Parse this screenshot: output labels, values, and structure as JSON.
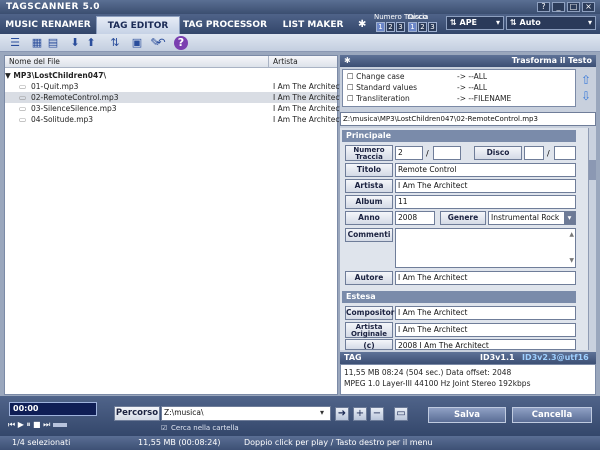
{
  "app": {
    "title": "TAGSCANNER 5.0",
    "window_buttons": [
      "?",
      "_",
      "□",
      "×"
    ]
  },
  "tabs": [
    {
      "label": "MUSIC RENAMER",
      "active": false
    },
    {
      "label": "TAG EDITOR",
      "active": true
    },
    {
      "label": "TAG PROCESSOR",
      "active": false
    },
    {
      "label": "LIST MAKER",
      "active": false
    }
  ],
  "topright": {
    "track_number_label": "Numero Traccia",
    "disc_label": "Disco",
    "track_digits": [
      "1",
      "2",
      "3"
    ],
    "disc_digits": [
      "1",
      "2",
      "3"
    ],
    "tag_format": "APE",
    "mode": "Auto"
  },
  "file_list": {
    "col_name": "Nome del File",
    "col_artist": "Artista",
    "folder": "MP3\\LostChildren047\\",
    "files": [
      {
        "name": "01-Quit.mp3",
        "artist": "I Am The Architect",
        "selected": false
      },
      {
        "name": "02-RemoteControl.mp3",
        "artist": "I Am The Architect",
        "selected": true
      },
      {
        "name": "03-SilenceSilence.mp3",
        "artist": "I Am The Architect",
        "selected": false
      },
      {
        "name": "04-Solitude.mp3",
        "artist": "I Am The Architect",
        "selected": false
      }
    ]
  },
  "transform": {
    "title": "Trasforma il Testo",
    "items": [
      {
        "label": "Change case",
        "target": "-> --ALL"
      },
      {
        "label": "Standard values",
        "target": "-> --ALL"
      },
      {
        "label": "Transliteration",
        "target": "-> --FILENAME"
      }
    ]
  },
  "path": "Z:\\musica\\MP3\\LostChildren047\\02-RemoteControl.mp3",
  "principale": {
    "section": "Principale",
    "track_label": "Numero Traccia",
    "track_value": "2",
    "track_sep": "/",
    "disc_label": "Disco",
    "disc_sep": "/",
    "title_label": "Titolo",
    "title_value": "Remote Control",
    "artist_label": "Artista",
    "artist_value": "I Am The Architect",
    "album_label": "Album",
    "album_value": "11",
    "year_label": "Anno",
    "year_value": "2008",
    "genre_label": "Genere",
    "genre_value": "Instrumental Rock",
    "comments_label": "Commenti",
    "author_label": "Autore",
    "author_value": "I Am The Architect"
  },
  "estesa": {
    "section": "Estesa",
    "composer_label": "Compositore",
    "composer_value": "I Am The Architect",
    "orig_artist_label": "Artista Originale",
    "orig_artist_value": "I Am The Architect",
    "copyright_label": "(c)",
    "copyright_value": "2008 I Am The Architect"
  },
  "tag_info": {
    "label": "TAG",
    "id3v1": "ID3v1.1",
    "id3v2": "ID3v2.3@utf16",
    "line1": "11,55 MB 08:24 (504 sec.)  Data offset: 2048",
    "line2": "MPEG 1.0  Layer-III  44100 Hz  Joint Stereo  192kbps"
  },
  "player": {
    "time": "00:00"
  },
  "bottom": {
    "path_label": "Percorso",
    "path_value": "Z:\\musica\\",
    "search_subfolder": "Cerca nella cartella",
    "save": "Salva",
    "cancel": "Cancella"
  },
  "status": {
    "selected": "1/4 selezionati",
    "size": "11,55 MB (00:08:24)",
    "hint": "Doppio click per play / Tasto destro per il menu"
  }
}
